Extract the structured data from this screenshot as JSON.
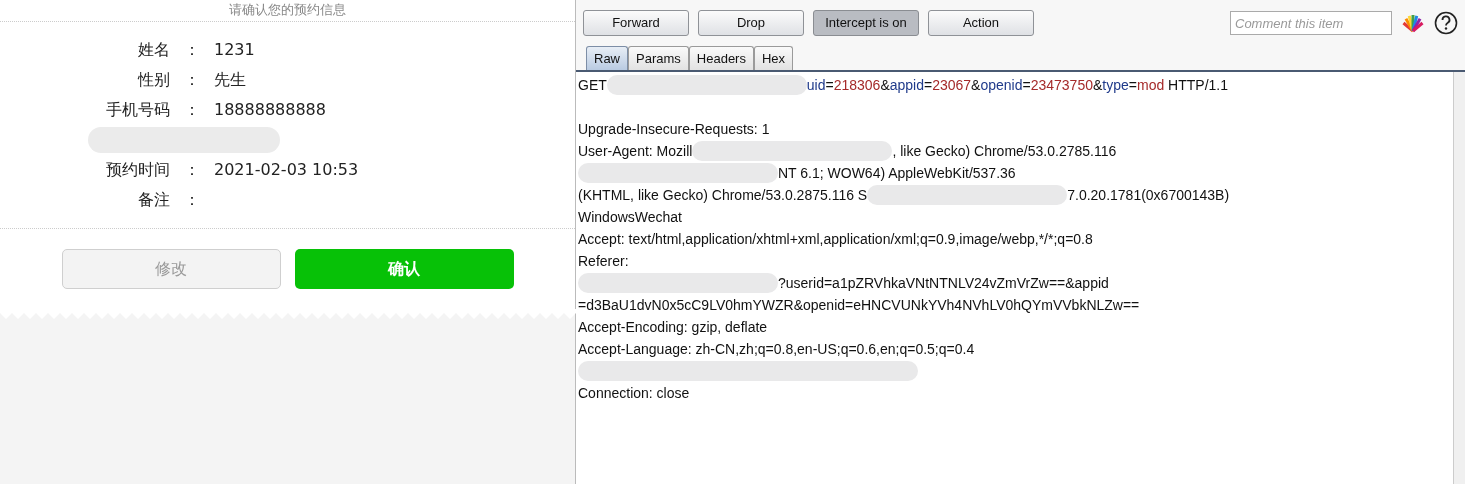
{
  "confirm_panel": {
    "heading": "请确认您的预约信息",
    "fields": [
      {
        "kind": "field",
        "label": "姓名",
        "separator": "：",
        "value": "1231"
      },
      {
        "kind": "field",
        "label": "性别",
        "separator": "：",
        "value": "先生"
      },
      {
        "kind": "field",
        "label": "手机号码",
        "separator": "：",
        "value": "18888888888"
      },
      {
        "kind": "redacted"
      },
      {
        "kind": "field",
        "label": "预约时间",
        "separator": "：",
        "value": "2021-02-03 10:53"
      },
      {
        "kind": "field",
        "label": "备注",
        "separator": "："
      }
    ],
    "buttons": [
      {
        "label": "修改",
        "disabled": true
      },
      {
        "label": "确认",
        "disabled": false
      }
    ]
  },
  "proxy": {
    "buttons": [
      {
        "label": "Forward",
        "pressed": false
      },
      {
        "label": "Drop",
        "pressed": false
      },
      {
        "label": "Intercept is on",
        "pressed": true
      },
      {
        "label": "Action",
        "pressed": false
      }
    ],
    "comment": {
      "placeholder": "Comment this item"
    },
    "tabs": [
      {
        "label": "Raw",
        "selected": true
      },
      {
        "label": "Params",
        "selected": false
      },
      {
        "label": "Headers",
        "selected": false
      },
      {
        "label": "Hex",
        "selected": false
      }
    ],
    "lines": [
      [
        {
          "kind": "plain",
          "text": "GET"
        },
        {
          "kind": "redacted"
        },
        {
          "kind": "name",
          "text": "uid"
        },
        {
          "kind": "plain",
          "text": "="
        },
        {
          "kind": "value",
          "text": "218306"
        },
        {
          "kind": "plain",
          "text": "&"
        },
        {
          "kind": "name",
          "text": "appid"
        },
        {
          "kind": "plain",
          "text": "="
        },
        {
          "kind": "value",
          "text": "23067"
        },
        {
          "kind": "plain",
          "text": "&"
        },
        {
          "kind": "name",
          "text": "openid"
        },
        {
          "kind": "plain",
          "text": "="
        },
        {
          "kind": "value",
          "text": "23473750"
        },
        {
          "kind": "plain",
          "text": "&"
        },
        {
          "kind": "name",
          "text": "type"
        },
        {
          "kind": "plain",
          "text": "="
        },
        {
          "kind": "value",
          "text": "mod"
        },
        {
          "kind": "plain",
          "text": " HTTP/1.1"
        }
      ],
      [
        {
          "kind": "plain",
          "text": "Upgrade-Insecure-Requests: 1"
        }
      ],
      [
        {
          "kind": "plain",
          "text": "User-Agent: Mozill"
        },
        {
          "kind": "redacted"
        },
        {
          "kind": "plain",
          "text": ", like Gecko) Chrome/53.0.2785.116"
        }
      ],
      [
        {
          "kind": "redacted"
        },
        {
          "kind": "plain",
          "text": "NT 6.1; WOW64) AppleWebKit/537.36"
        }
      ],
      [
        {
          "kind": "plain",
          "text": "(KHTML, like Gecko) Chrome/53.0.2875.116 S"
        },
        {
          "kind": "redacted"
        },
        {
          "kind": "plain",
          "text": "7.0.20.1781(0x6700143B)"
        }
      ],
      [
        {
          "kind": "plain",
          "text": "WindowsWechat"
        }
      ],
      [
        {
          "kind": "plain",
          "text": "Accept: text/html,application/xhtml+xml,application/xml;q=0.9,image/webp,*/*;q=0.8"
        }
      ],
      [
        {
          "kind": "plain",
          "text": "Referer:"
        }
      ],
      [
        {
          "kind": "redacted"
        },
        {
          "kind": "plain",
          "text": "?userid=a1pZRVhkaVNtNTNLV24vZmVrZw==&appid"
        }
      ],
      [
        {
          "kind": "plain",
          "text": "=d3BaU1dvN0x5cC9LV0hmYWZR&openid=eHNCVUNkYVh4NVhLV0hQYmVVbkNLZw=="
        }
      ],
      [
        {
          "kind": "plain",
          "text": "Accept-Encoding: gzip, deflate"
        }
      ],
      [
        {
          "kind": "plain",
          "text": "Accept-Language: zh-CN,zh;q=0.8,en-US;q=0.6,en;q=0.5;q=0.4"
        }
      ],
      [
        {
          "kind": "redacted"
        }
      ],
      [
        {
          "kind": "plain",
          "text": "Connection: close"
        }
      ]
    ]
  }
}
